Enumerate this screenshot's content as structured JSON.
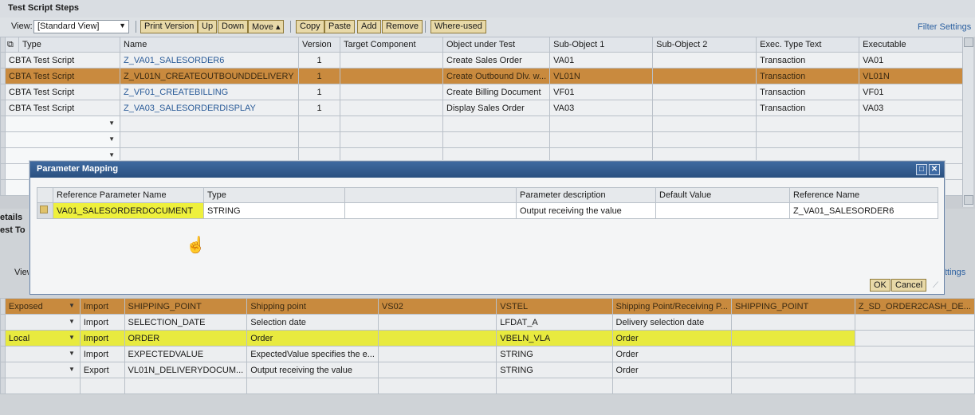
{
  "panel": {
    "title": "Test Script Steps"
  },
  "toolbar": {
    "view_label": "View:",
    "view_value": "[Standard View]",
    "buttons": [
      "Print Version",
      "Up",
      "Down",
      "Move ▴",
      "Copy",
      "Paste",
      "Add",
      "Remove",
      "Where-used"
    ],
    "filter_settings": "Filter Settings"
  },
  "steps": {
    "columns": [
      "Type",
      "Name",
      "Version",
      "Target Component",
      "Object under Test",
      "Sub-Object 1",
      "Sub-Object 2",
      "Exec. Type Text",
      "Executable"
    ],
    "rows": [
      [
        "CBTA Test Script",
        "Z_VA01_SALESORDER6",
        "1",
        "",
        "Create Sales Order",
        "VA01",
        "",
        "Transaction",
        "VA01"
      ],
      [
        "CBTA Test Script",
        "Z_VL01N_CREATEOUTBOUNDDELIVERY",
        "1",
        "",
        "Create Outbound Dlv. w...",
        "VL01N",
        "",
        "Transaction",
        "VL01N"
      ],
      [
        "CBTA Test Script",
        "Z_VF01_CREATEBILLING",
        "1",
        "",
        "Create Billing Document",
        "VF01",
        "",
        "Transaction",
        "VF01"
      ],
      [
        "CBTA Test Script",
        "Z_VA03_SALESORDERDISPLAY",
        "1",
        "",
        "Display Sales Order",
        "VA03",
        "",
        "Transaction",
        "VA03"
      ]
    ]
  },
  "side_labels": {
    "details": "etails",
    "test": "est To",
    "view": "View",
    "settings": "ttings"
  },
  "dialog": {
    "title": "Parameter Mapping",
    "columns": [
      "Reference Parameter Name",
      "Type",
      "",
      "Parameter description",
      "Default Value",
      "Reference Name"
    ],
    "rows": [
      [
        "VA01_SALESORDERDOCUMENT",
        "STRING",
        "",
        "Output receiving the value",
        "",
        "Z_VA01_SALESORDER6"
      ]
    ],
    "ok": "OK",
    "cancel": "Cancel"
  },
  "params": {
    "rows": [
      [
        "Exposed",
        "Import",
        "SHIPPING_POINT",
        "Shipping point",
        "VS02",
        "VSTEL",
        "Shipping Point/Receiving P...",
        "SHIPPING_POINT",
        "Z_SD_ORDER2CASH_DE..."
      ],
      [
        "",
        "Import",
        "SELECTION_DATE",
        "Selection date",
        "",
        "LFDAT_A",
        "Delivery selection date",
        "",
        ""
      ],
      [
        "Local",
        "Import",
        "ORDER",
        "Order",
        "",
        "VBELN_VLA",
        "Order",
        "",
        ""
      ],
      [
        "",
        "Import",
        "EXPECTEDVALUE",
        "ExpectedValue specifies the e...",
        "",
        "STRING",
        "Order",
        "",
        ""
      ],
      [
        "",
        "Export",
        "VL01N_DELIVERYDOCUM...",
        "Output receiving the value",
        "",
        "STRING",
        "Order",
        "",
        ""
      ]
    ]
  },
  "colors": {
    "highlight_orange": "#c98a3e",
    "highlight_yellow": "#eef03c",
    "dialog_title": "#2f5a8e"
  }
}
